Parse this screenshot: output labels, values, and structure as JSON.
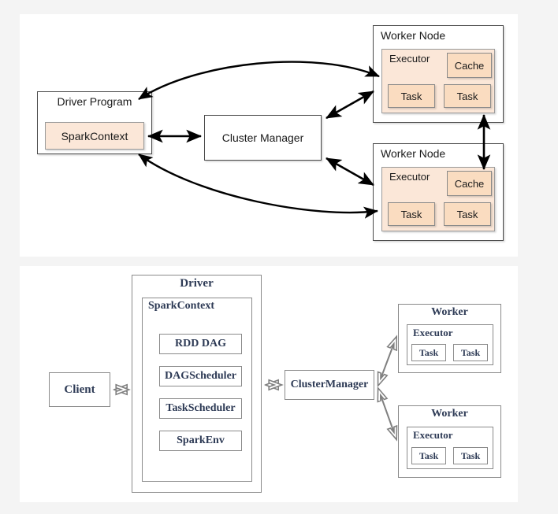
{
  "page": {
    "background": "#f4f4f4",
    "panel_background": "#ffffff"
  },
  "colors": {
    "peach_light": "#fbe7d8",
    "peach_mid": "#fadcc0",
    "outline_dark": "#4a4a4a",
    "outline_grey": "#8a8a8a",
    "text_dark": "#1a1a1a",
    "text_serif": "#2d3a55",
    "arrow_solid": "#000000",
    "arrow_hollow_stroke": "#808080"
  },
  "top_diagram": {
    "driver_program": {
      "label": "Driver Program",
      "spark_context": "SparkContext"
    },
    "cluster_manager": "Cluster Manager",
    "worker_nodes": [
      {
        "label": "Worker Node",
        "executor": "Executor",
        "cache": "Cache",
        "tasks": [
          "Task",
          "Task"
        ]
      },
      {
        "label": "Worker Node",
        "executor": "Executor",
        "cache": "Cache",
        "tasks": [
          "Task",
          "Task"
        ]
      }
    ]
  },
  "bottom_diagram": {
    "client": "Client",
    "driver": {
      "label": "Driver",
      "spark_context": {
        "label": "SparkContext",
        "components": [
          "RDD DAG",
          "DAGScheduler",
          "TaskScheduler",
          "SparkEnv"
        ]
      }
    },
    "cluster_manager": "ClusterManager",
    "workers": [
      {
        "label": "Worker",
        "executor": "Executor",
        "tasks": [
          "Task",
          "Task"
        ]
      },
      {
        "label": "Worker",
        "executor": "Executor",
        "tasks": [
          "Task",
          "Task"
        ]
      }
    ]
  }
}
